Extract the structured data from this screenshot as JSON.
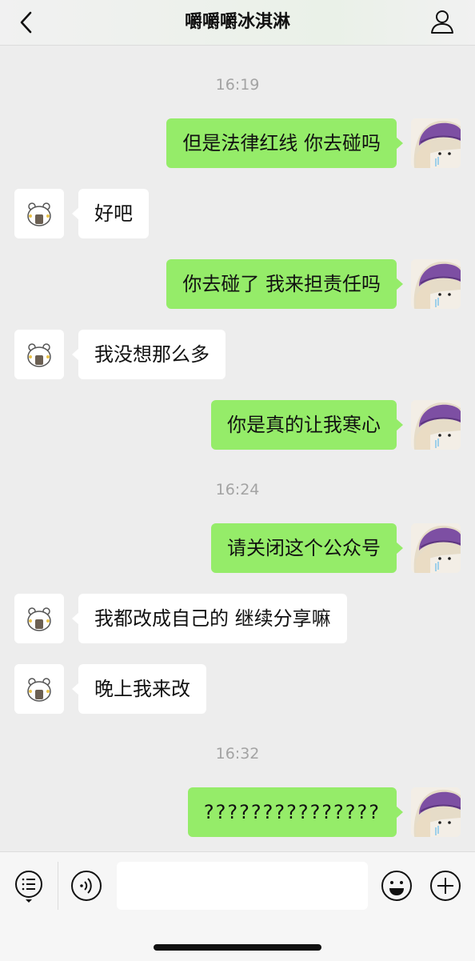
{
  "header": {
    "title": "嚼嚼嚼冰淇淋",
    "back_icon": "chevron-left-icon",
    "profile_icon": "person-icon"
  },
  "colors": {
    "my_bubble": "#95ec69",
    "their_bubble": "#ffffff",
    "background": "#ededed"
  },
  "messages": {
    "t1": "16:19",
    "m1": "但是法律红线 你去碰吗",
    "m2": "好吧",
    "m3": "你去碰了 我来担责任吗",
    "m4": "我没想那么多",
    "m5": "你是真的让我寒心",
    "t2": "16:24",
    "m6": "请关闭这个公众号",
    "m7": "我都改成自己的 继续分享嘛",
    "m8": "晚上我来改",
    "t3": "16:32",
    "m9": "???????????????"
  },
  "input_bar": {
    "left_icon": "list-menu-icon",
    "voice_icon": "voice-icon",
    "input_value": "",
    "emoji_icon": "smiley-icon",
    "plus_icon": "plus-icon"
  }
}
